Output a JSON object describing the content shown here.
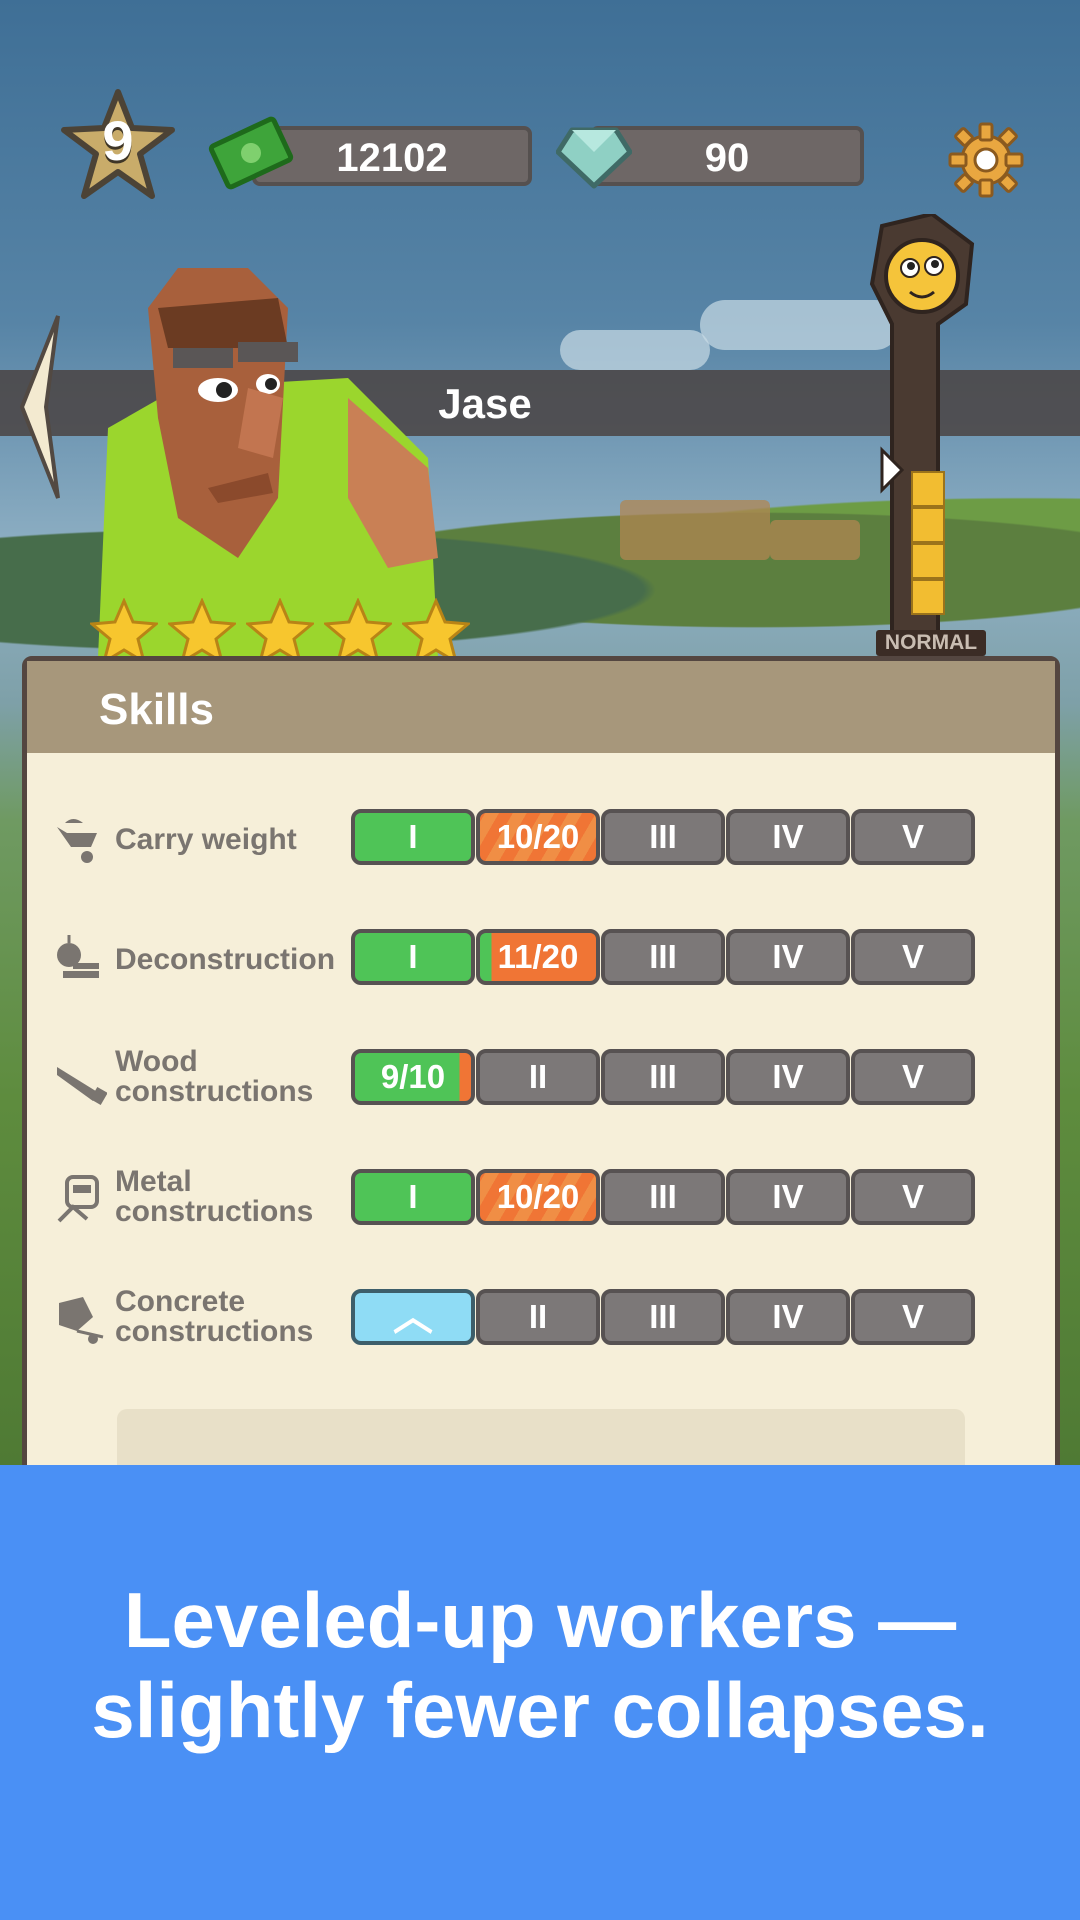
{
  "hud": {
    "level": "9",
    "cash": "12102",
    "gems": "90"
  },
  "worker": {
    "name": "Jase",
    "stars": 5,
    "mood_meter_label": "NORMAL"
  },
  "skills": {
    "title": "Skills",
    "rows": [
      {
        "label": "Carry weight",
        "segments": [
          "I",
          "10/20",
          "III",
          "IV",
          "V"
        ]
      },
      {
        "label": "Deconstruction",
        "segments": [
          "I",
          "11/20",
          "III",
          "IV",
          "V"
        ]
      },
      {
        "label": "Wood constructions",
        "segments": [
          "9/10",
          "II",
          "III",
          "IV",
          "V"
        ]
      },
      {
        "label": "Metal constructions",
        "segments": [
          "I",
          "10/20",
          "III",
          "IV",
          "V"
        ]
      },
      {
        "label": "Concrete constructions",
        "segments": [
          "",
          "II",
          "III",
          "IV",
          "V"
        ]
      }
    ]
  },
  "caption": {
    "line1": "Leveled-up workers —",
    "line2": "slightly fewer collapses."
  },
  "colors": {
    "caption_bg": "#4a90f5",
    "complete": "#4fc457",
    "in_progress": "#f07535",
    "locked": "#7c7878",
    "upgrade": "#8fdcf5"
  }
}
